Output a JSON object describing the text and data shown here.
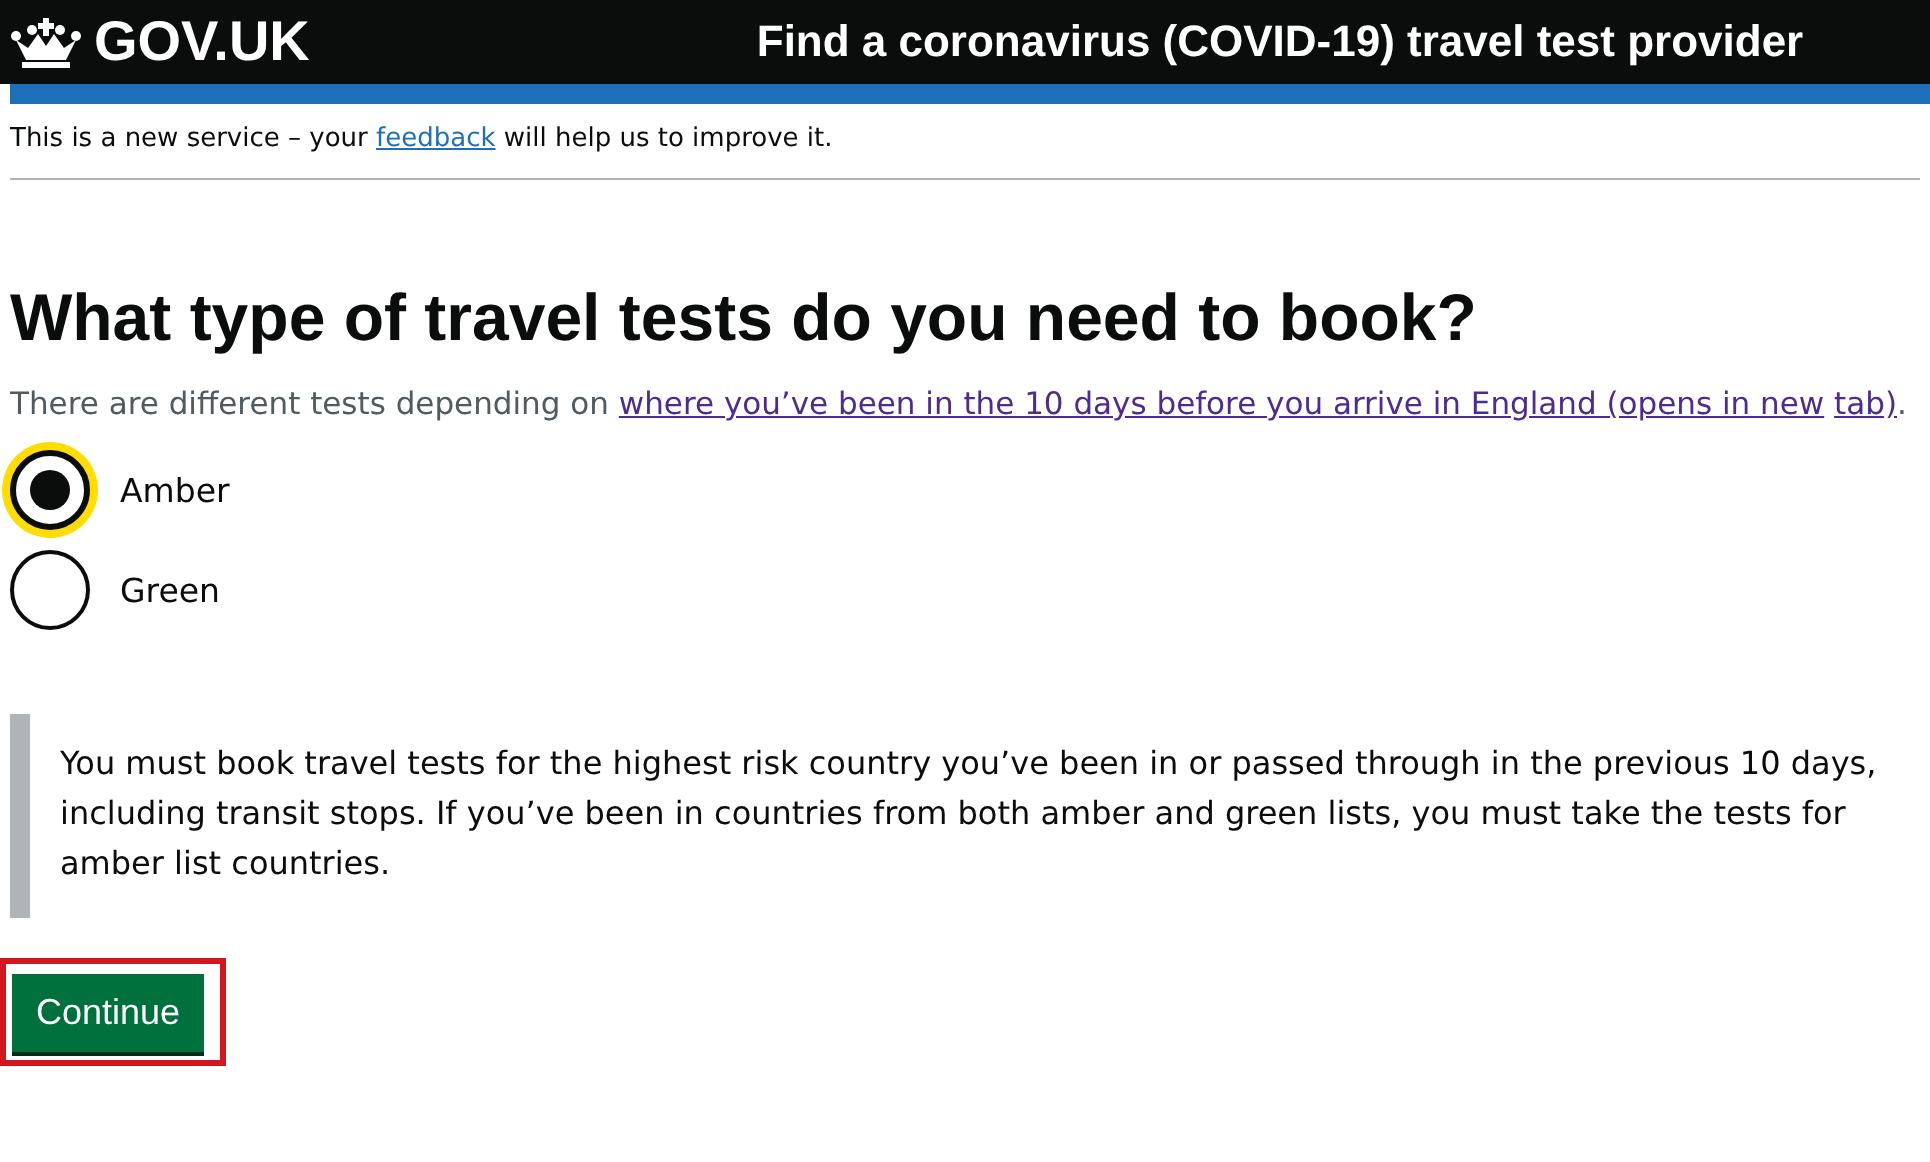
{
  "header": {
    "logo": "GOV.UK",
    "service_name": "Find a coronavirus (COVID-19) travel test provider"
  },
  "phase_banner": {
    "before": "This is a new service – your",
    "link": "feedback",
    "after": "will help us to improve it."
  },
  "question": {
    "title": "What type of travel tests do you need to book?",
    "hint_before": "There are different tests depending on",
    "hint_link_parts": [
      "where you’ve been in the 10 days before you arrive in England (opens in new",
      "tab)"
    ],
    "hint_after": "."
  },
  "options": [
    {
      "label": "Amber",
      "selected": true,
      "focused": true
    },
    {
      "label": "Green",
      "selected": false,
      "focused": false
    }
  ],
  "inset_text": "You must book travel tests for the highest risk country you’ve been in or passed through in the previous 10 days, including transit stops. If you’ve been in countries from both amber and green lists, you must take the tests for amber list countries.",
  "continue_button": {
    "label": "Continue",
    "highlighted": true
  }
}
